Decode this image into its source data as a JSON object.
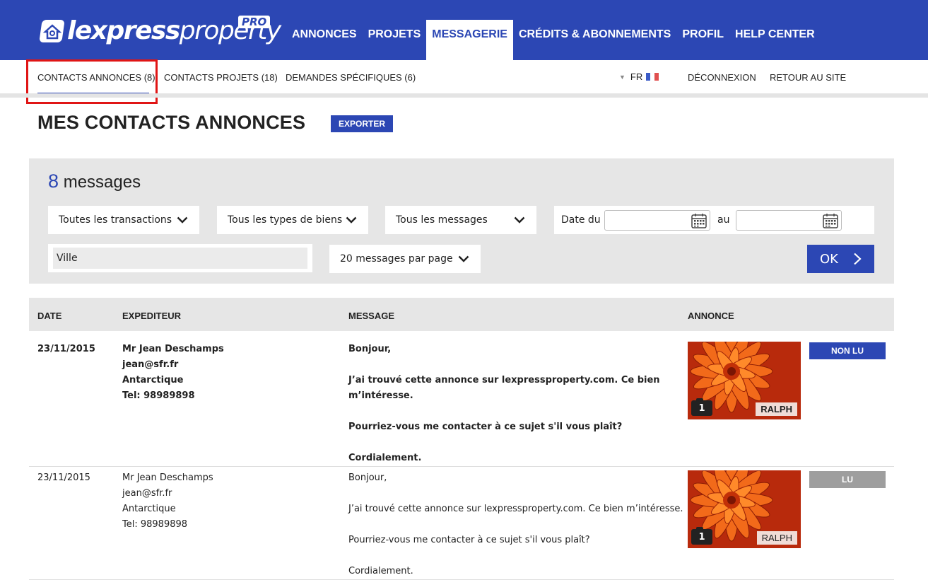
{
  "brand": {
    "name_light": "lexpress",
    "name_rest": "property",
    "badge": "PRO"
  },
  "main_nav": [
    {
      "label": "ANNONCES",
      "active": false
    },
    {
      "label": "PROJETS",
      "active": false
    },
    {
      "label": "MESSAGERIE",
      "active": true
    },
    {
      "label": "CRÉDITS & ABONNEMENTS",
      "active": false
    },
    {
      "label": "PROFIL",
      "active": false
    },
    {
      "label": "HELP CENTER",
      "active": false
    }
  ],
  "sub_nav": {
    "tabs": [
      {
        "label": "CONTACTS ANNONCES (8)",
        "active": true
      },
      {
        "label": "CONTACTS PROJETS (18)",
        "active": false
      },
      {
        "label": "DEMANDES SPÉCIFIQUES (6)",
        "active": false
      }
    ],
    "language": "FR",
    "logout": "DÉCONNEXION",
    "back_to_site": "RETOUR AU SITE"
  },
  "page": {
    "title": "MES CONTACTS ANNONCES",
    "export_label": "EXPORTER"
  },
  "filters": {
    "count": "8",
    "count_label": "messages",
    "transactions": "Toutes les transactions",
    "property_types": "Tous les types de biens",
    "messages": "Tous les messages",
    "date_from_label": "Date du",
    "date_to_label": "au",
    "city_value": "Ville",
    "per_page": "20 messages par page",
    "ok_label": "OK"
  },
  "table": {
    "headers": {
      "date": "DATE",
      "sender": "EXPEDITEUR",
      "message": "MESSAGE",
      "listing": "ANNONCE"
    },
    "rows": [
      {
        "date": "23/11/2015",
        "name": "Mr Jean Deschamps",
        "email": "jean@sfr.fr",
        "location": "Antarctique",
        "phone": "Tel: 98989898",
        "msg_greeting": "Bonjour,",
        "msg_body_1": "J’ai trouvé cette annonce sur lexpressproperty.com. Ce bien",
        "msg_body_2": "m’intéresse.",
        "msg_question": "Pourriez-vous me contacter à ce sujet s'il vous plaît?",
        "msg_closing": "Cordialement.",
        "photo_count": "1",
        "agent": "RALPH",
        "status": "NON LU",
        "status_color": "#2c47b4"
      },
      {
        "date": "23/11/2015",
        "name": "Mr Jean Deschamps",
        "email": "jean@sfr.fr",
        "location": "Antarctique",
        "phone": "Tel: 98989898",
        "msg_greeting": "Bonjour,",
        "msg_body_1": "J’ai trouvé cette annonce sur lexpressproperty.com. Ce bien m’intéresse.",
        "msg_body_2": "",
        "msg_question": "Pourriez-vous me contacter à ce sujet s'il vous plaît?",
        "msg_closing": "Cordialement.",
        "photo_count": "1",
        "agent": "RALPH",
        "status": "LU",
        "status_color": "#9e9e9e"
      }
    ]
  },
  "colors": {
    "brand_blue": "#2c47b4",
    "highlight_red": "#e01515",
    "panel_grey": "#e6e6e6"
  }
}
